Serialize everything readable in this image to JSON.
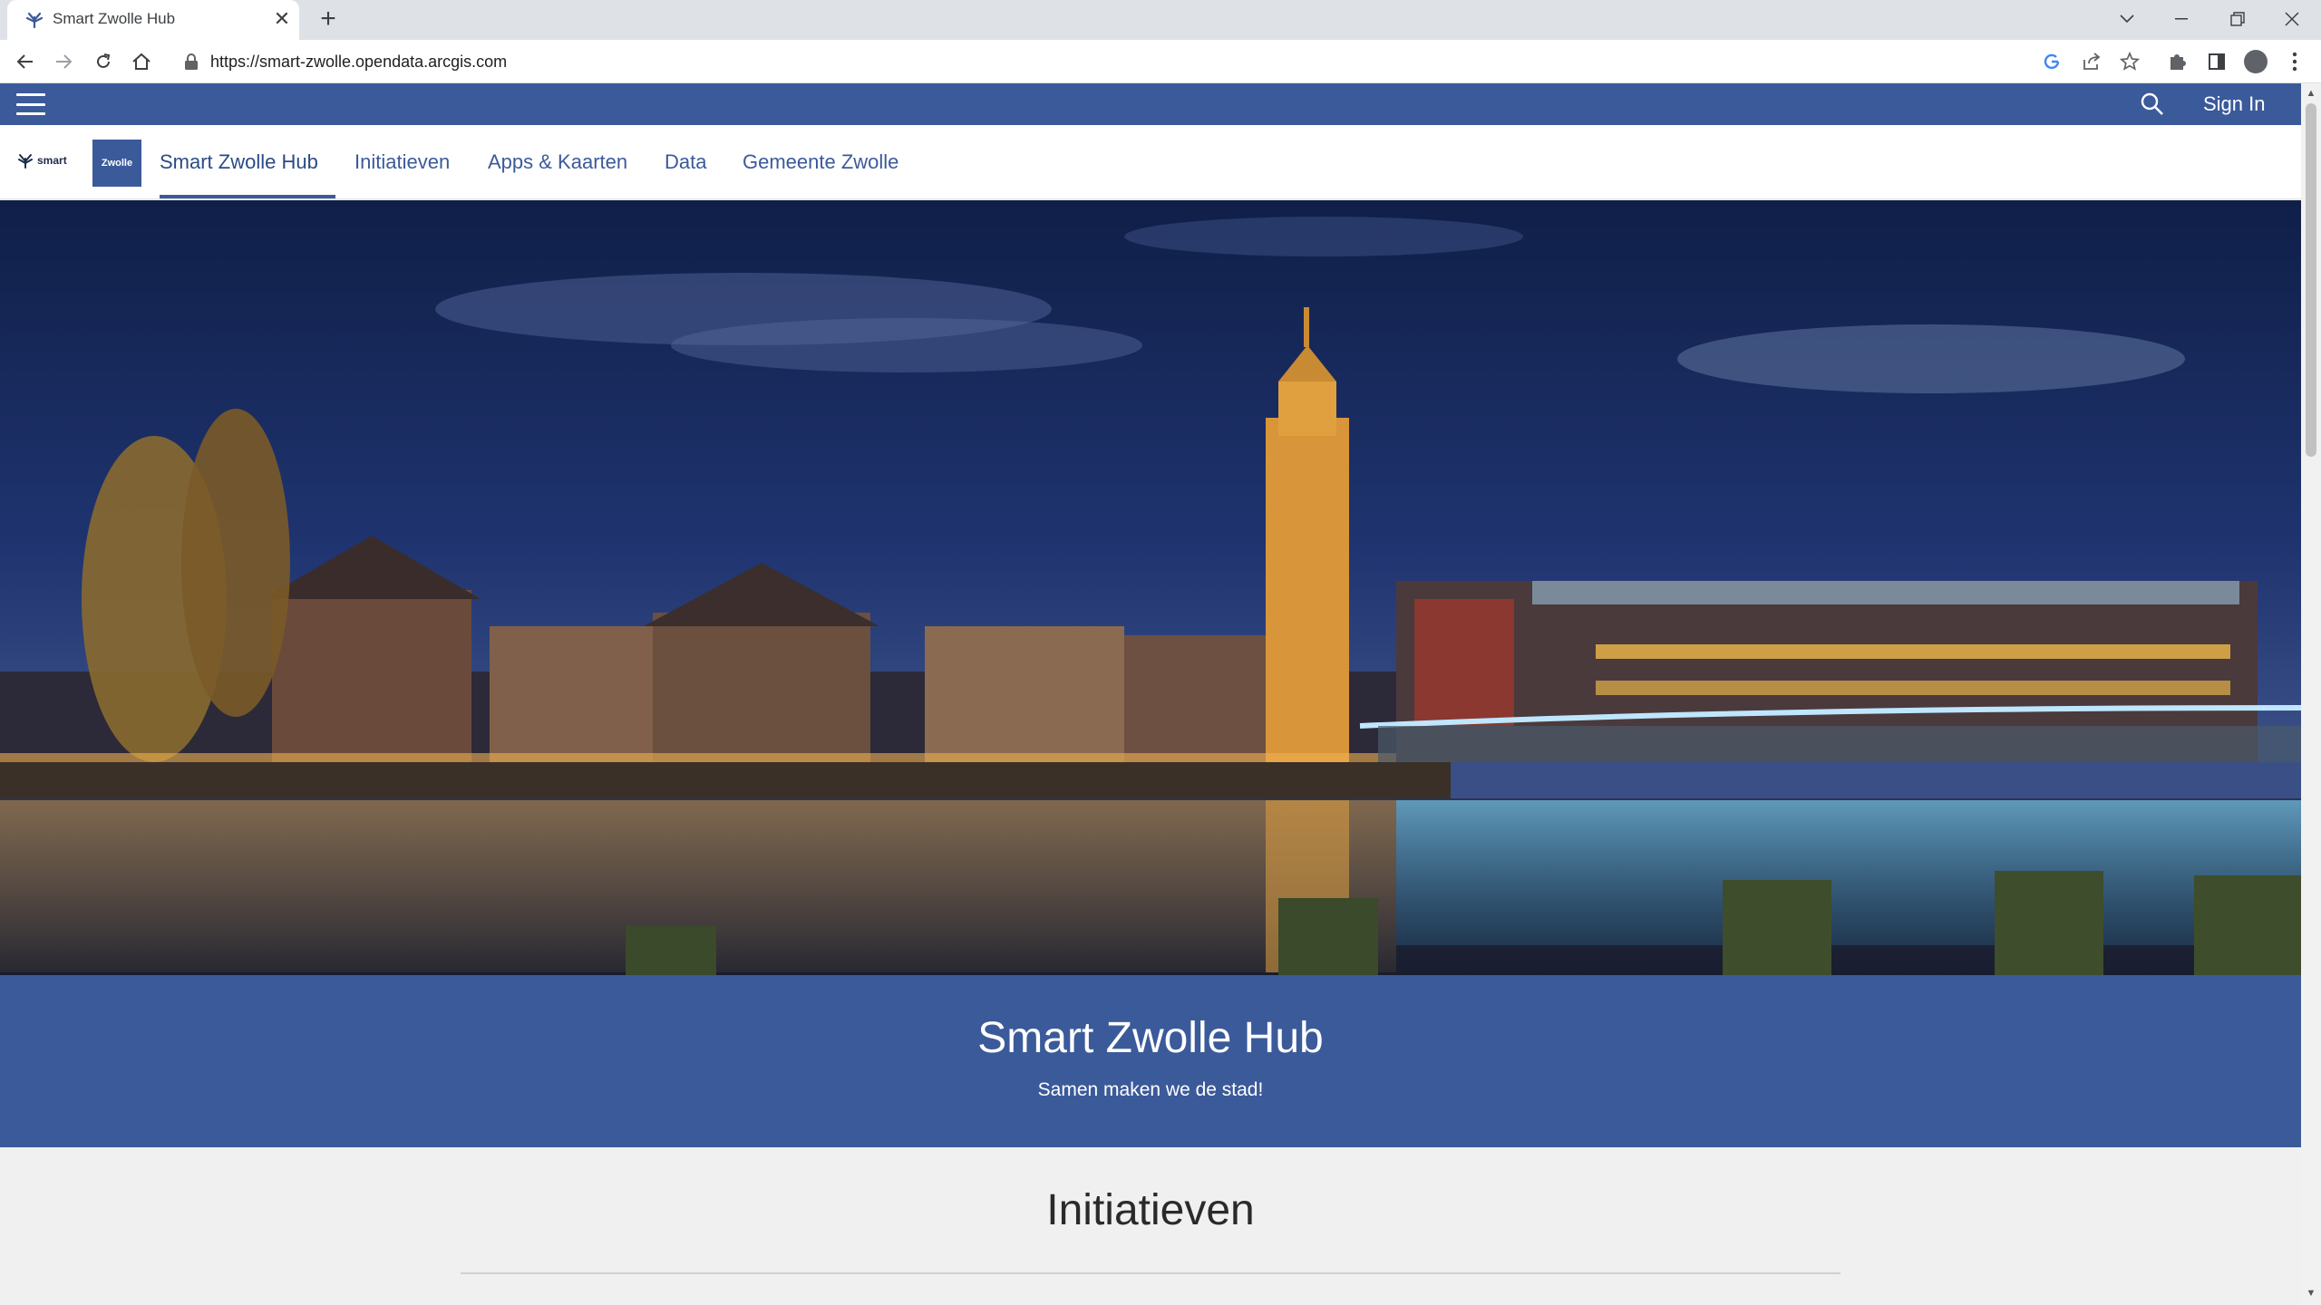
{
  "browser": {
    "tab_title": "Smart Zwolle Hub",
    "url": "https://smart-zwolle.opendata.arcgis.com"
  },
  "site": {
    "sign_in": "Sign In",
    "logo_smart_text": "smart",
    "logo_zwolle_text": "Zwolle",
    "nav": [
      {
        "label": "Smart Zwolle Hub",
        "active": true
      },
      {
        "label": "Initiatieven",
        "active": false
      },
      {
        "label": "Apps & Kaarten",
        "active": false
      },
      {
        "label": "Data",
        "active": false
      },
      {
        "label": "Gemeente Zwolle",
        "active": false
      }
    ],
    "accent_color": "#3b5a9a"
  },
  "banner": {
    "title": "Smart Zwolle Hub",
    "subtitle": "Samen maken we de stad!"
  },
  "section": {
    "title": "Initiatieven"
  }
}
